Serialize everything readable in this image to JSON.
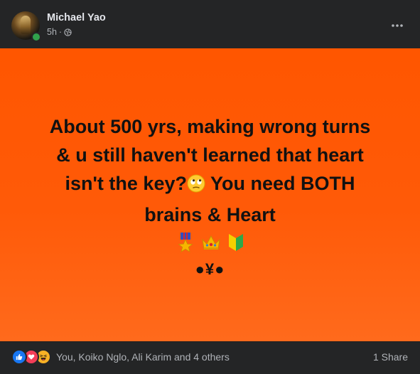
{
  "post": {
    "author": "Michael Yao",
    "time": "5h",
    "separator": "·",
    "privacy_icon": "globe-icon",
    "more_icon": "more-options-icon",
    "text_lines": [
      "About 500 yrs, making wrong turns",
      "& u still haven't learned that heart",
      "isn't the key?",
      "You need BOTH",
      "brains & Heart"
    ],
    "inline_emoji": "face-with-rolling-eyes",
    "emoji_row": [
      "military-medal",
      "crown",
      "japanese-beginner-symbol"
    ],
    "symbol_line": "●¥●",
    "background_color": "#ff5600"
  },
  "footer": {
    "reaction_icons": [
      "like",
      "love",
      "haha"
    ],
    "reaction_text": "You, Koiko Nglo, Ali Karim and 4 others",
    "share_count": "1 Share"
  },
  "colors": {
    "card_bg": "#242526",
    "text_primary": "#e4e6eb",
    "text_secondary": "#b0b3b8",
    "online": "#31a24c",
    "like": "#1877f2",
    "love": "#f33e58",
    "haha": "#f7b125"
  }
}
